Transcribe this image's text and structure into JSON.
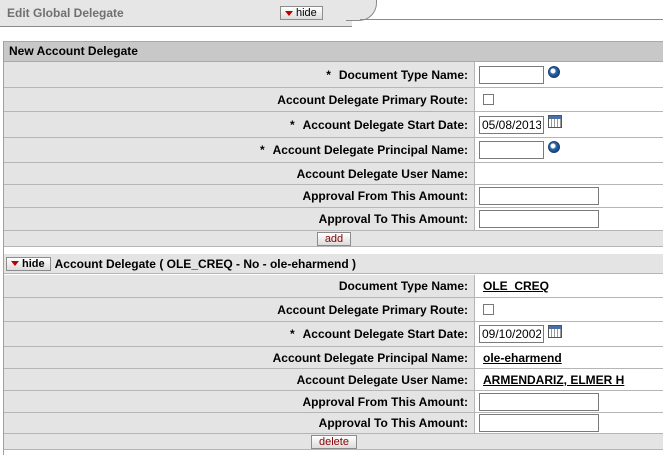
{
  "tab": {
    "title": "Edit Global Delegate",
    "hide_label": "hide"
  },
  "new_section": {
    "header": "New Account Delegate",
    "fields": {
      "doc_type_label": "Document Type Name:",
      "primary_route_label": "Account Delegate Primary Route:",
      "start_date_label": "Account Delegate Start Date:",
      "start_date_value": "05/08/2013",
      "principal_label": "Account Delegate Principal Name:",
      "user_name_label": "Account Delegate User Name:",
      "from_amount_label": "Approval From This Amount:",
      "to_amount_label": "Approval To This Amount:"
    },
    "required_mark": "*",
    "add_label": "add"
  },
  "existing_section": {
    "hide_label": "hide",
    "header": "Account Delegate ( OLE_CREQ - No - ole-eharmend )",
    "fields": {
      "doc_type_label": "Document Type Name:",
      "doc_type_value": "OLE_CREQ",
      "primary_route_label": "Account Delegate Primary Route:",
      "start_date_label": "Account Delegate Start Date:",
      "start_date_value": "09/10/2002",
      "principal_label": "Account Delegate Principal Name:",
      "principal_value": "ole-eharmend",
      "user_name_label": "Account Delegate User Name:",
      "user_name_value": "ARMENDARIZ, ELMER H",
      "from_amount_label": "Approval From This Amount:",
      "to_amount_label": "Approval To This Amount:"
    },
    "required_mark": "*",
    "delete_label": "delete"
  },
  "icons": {
    "lookup": "magnifier-lookup-icon",
    "calendar": "calendar-icon",
    "collapse": "triangle-down-icon"
  }
}
